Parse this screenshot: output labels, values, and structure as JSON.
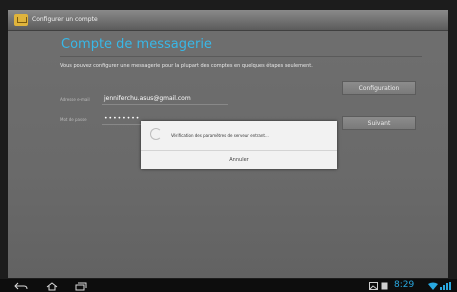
{
  "app": {
    "title": "Configurer un compte"
  },
  "main": {
    "heading": "Compte de messagerie",
    "description": "Vous pouvez configurer une messagerie pour la plupart des comptes en quelques étapes seulement.",
    "email": {
      "label": "Adresse e-mail",
      "value": "jenniferchu.asus@gmail.com"
    },
    "password": {
      "label": "Mot de passe",
      "value": "••••••••"
    },
    "buttons": {
      "manual_setup": "Configuration",
      "next": "Suivant"
    }
  },
  "dialog": {
    "message": "Vérification des paramètres de serveur entrant...",
    "cancel": "Annuler"
  },
  "statusbar": {
    "time": "8:29"
  },
  "colors": {
    "accent": "#38b8e8",
    "clock": "#29a8e0",
    "dialog_bg": "#f2f2f2"
  },
  "icons": [
    "back-icon",
    "home-icon",
    "recent-apps-icon",
    "gallery-notification-icon",
    "download-notification-icon",
    "wifi-icon",
    "signal-icon"
  ]
}
